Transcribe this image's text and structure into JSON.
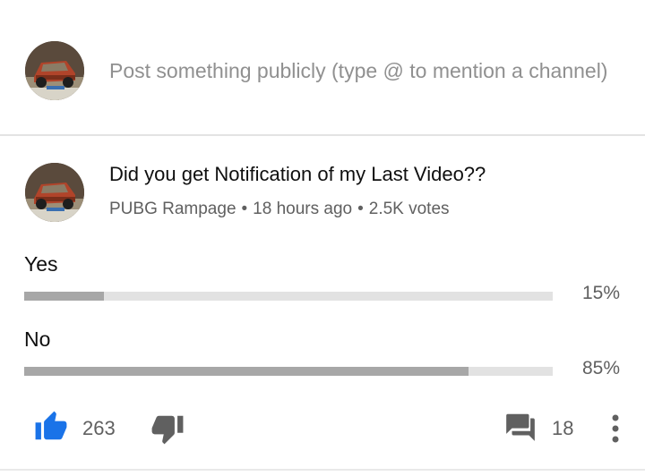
{
  "compose": {
    "placeholder": "Post something publicly (type @ to mention a channel)"
  },
  "post": {
    "title": "Did you get Notification of my Last Video??",
    "channel": "PUBG Rampage",
    "time": "18 hours ago",
    "votes": "2.5K votes",
    "options": [
      {
        "label": "Yes",
        "percent_text": "15%",
        "fraction": 0.15
      },
      {
        "label": "No",
        "percent_text": "85%",
        "fraction": 0.84
      }
    ],
    "actions": {
      "like_count": "263",
      "comment_count": "18"
    }
  },
  "colors": {
    "like_blue": "#1a73e8",
    "bar_fill": "#a7a7a7",
    "bar_track": "#e2e2e2",
    "icon_gray": "#606060"
  },
  "icons": [
    "thumb-up-icon",
    "thumb-down-icon",
    "comment-icon",
    "more-vert-icon"
  ]
}
